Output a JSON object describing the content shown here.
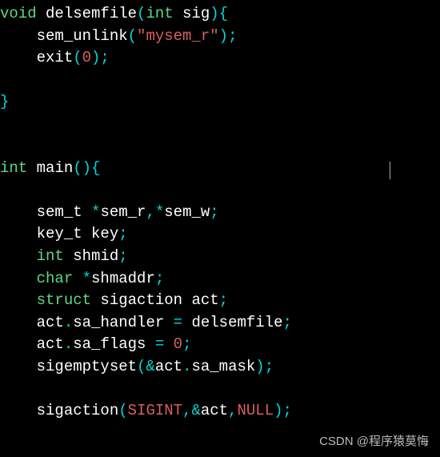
{
  "code": {
    "lines": [
      [
        {
          "cls": "tok-type",
          "t": "void"
        },
        {
          "cls": "tok-plain",
          "t": " delsemfile"
        },
        {
          "cls": "tok-punct",
          "t": "("
        },
        {
          "cls": "tok-type",
          "t": "int"
        },
        {
          "cls": "tok-plain",
          "t": " sig"
        },
        {
          "cls": "tok-punct",
          "t": "){"
        }
      ],
      [
        {
          "cls": "tok-plain",
          "t": "    sem_unlink"
        },
        {
          "cls": "tok-punct",
          "t": "("
        },
        {
          "cls": "tok-string",
          "t": "\"mysem_r\""
        },
        {
          "cls": "tok-punct",
          "t": ");"
        }
      ],
      [
        {
          "cls": "tok-plain",
          "t": "    exit"
        },
        {
          "cls": "tok-punct",
          "t": "("
        },
        {
          "cls": "tok-number",
          "t": "0"
        },
        {
          "cls": "tok-punct",
          "t": ");"
        }
      ],
      [
        {
          "cls": "tok-plain",
          "t": ""
        }
      ],
      [
        {
          "cls": "tok-punct",
          "t": "}"
        }
      ],
      [
        {
          "cls": "tok-plain",
          "t": ""
        }
      ],
      [
        {
          "cls": "tok-plain",
          "t": ""
        }
      ],
      [
        {
          "cls": "tok-type",
          "t": "int"
        },
        {
          "cls": "tok-plain",
          "t": " main"
        },
        {
          "cls": "tok-punct",
          "t": "(){"
        }
      ],
      [
        {
          "cls": "tok-plain",
          "t": ""
        }
      ],
      [
        {
          "cls": "tok-plain",
          "t": "    sem_t "
        },
        {
          "cls": "tok-operator",
          "t": "*"
        },
        {
          "cls": "tok-plain",
          "t": "sem_r"
        },
        {
          "cls": "tok-punct",
          "t": ",*"
        },
        {
          "cls": "tok-plain",
          "t": "sem_w"
        },
        {
          "cls": "tok-punct",
          "t": ";"
        }
      ],
      [
        {
          "cls": "tok-plain",
          "t": "    key_t key"
        },
        {
          "cls": "tok-punct",
          "t": ";"
        }
      ],
      [
        {
          "cls": "tok-plain",
          "t": "    "
        },
        {
          "cls": "tok-type",
          "t": "int"
        },
        {
          "cls": "tok-plain",
          "t": " shmid"
        },
        {
          "cls": "tok-punct",
          "t": ";"
        }
      ],
      [
        {
          "cls": "tok-plain",
          "t": "    "
        },
        {
          "cls": "tok-type",
          "t": "char"
        },
        {
          "cls": "tok-plain",
          "t": " "
        },
        {
          "cls": "tok-operator",
          "t": "*"
        },
        {
          "cls": "tok-plain",
          "t": "shmaddr"
        },
        {
          "cls": "tok-punct",
          "t": ";"
        }
      ],
      [
        {
          "cls": "tok-plain",
          "t": "    "
        },
        {
          "cls": "tok-keyword",
          "t": "struct"
        },
        {
          "cls": "tok-plain",
          "t": " sigaction act"
        },
        {
          "cls": "tok-punct",
          "t": ";"
        }
      ],
      [
        {
          "cls": "tok-plain",
          "t": "    act"
        },
        {
          "cls": "tok-punct",
          "t": "."
        },
        {
          "cls": "tok-plain",
          "t": "sa_handler "
        },
        {
          "cls": "tok-operator",
          "t": "="
        },
        {
          "cls": "tok-plain",
          "t": " delsemfile"
        },
        {
          "cls": "tok-punct",
          "t": ";"
        }
      ],
      [
        {
          "cls": "tok-plain",
          "t": "    act"
        },
        {
          "cls": "tok-punct",
          "t": "."
        },
        {
          "cls": "tok-plain",
          "t": "sa_flags "
        },
        {
          "cls": "tok-operator",
          "t": "="
        },
        {
          "cls": "tok-plain",
          "t": " "
        },
        {
          "cls": "tok-number",
          "t": "0"
        },
        {
          "cls": "tok-punct",
          "t": ";"
        }
      ],
      [
        {
          "cls": "tok-plain",
          "t": "    sigemptyset"
        },
        {
          "cls": "tok-punct",
          "t": "(&"
        },
        {
          "cls": "tok-plain",
          "t": "act"
        },
        {
          "cls": "tok-punct",
          "t": "."
        },
        {
          "cls": "tok-plain",
          "t": "sa_mask"
        },
        {
          "cls": "tok-punct",
          "t": ");"
        }
      ],
      [
        {
          "cls": "tok-plain",
          "t": ""
        }
      ],
      [
        {
          "cls": "tok-plain",
          "t": "    sigaction"
        },
        {
          "cls": "tok-punct",
          "t": "("
        },
        {
          "cls": "tok-constant",
          "t": "SIGINT"
        },
        {
          "cls": "tok-punct",
          "t": ",&"
        },
        {
          "cls": "tok-plain",
          "t": "act"
        },
        {
          "cls": "tok-punct",
          "t": ","
        },
        {
          "cls": "tok-constant",
          "t": "NULL"
        },
        {
          "cls": "tok-punct",
          "t": ");"
        }
      ]
    ]
  },
  "watermark": "CSDN @程序猿莫悔"
}
